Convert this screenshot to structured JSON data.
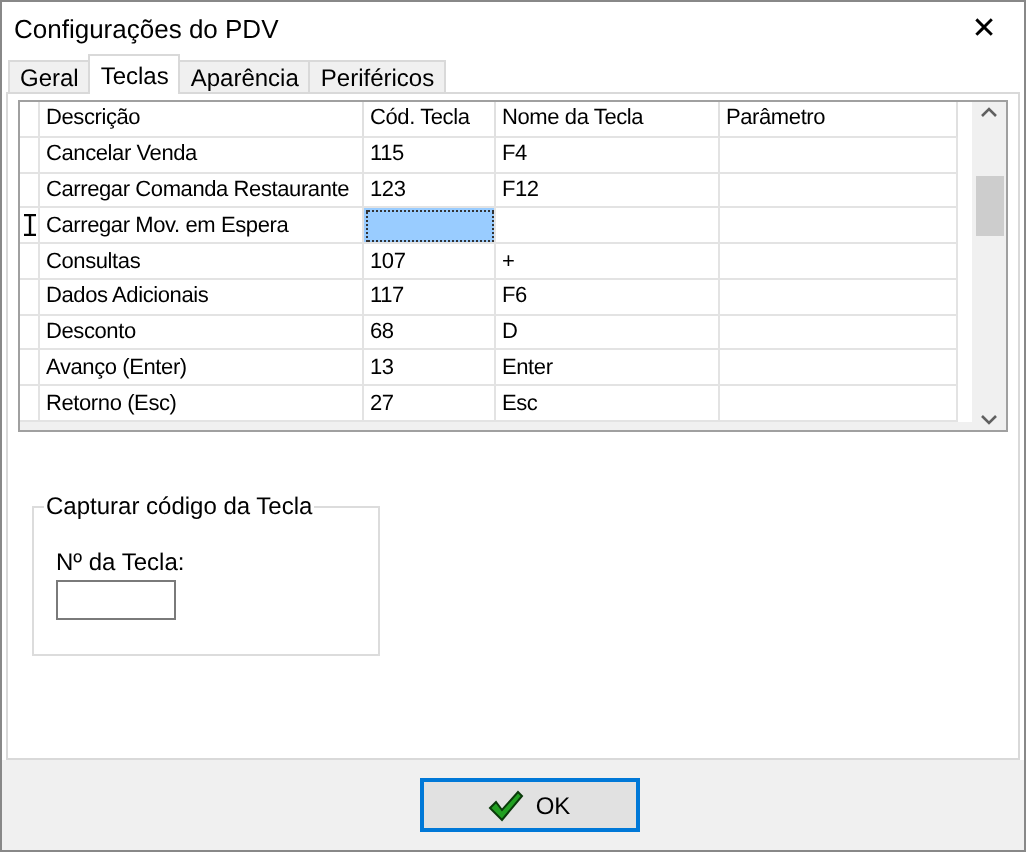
{
  "window": {
    "title": "Configurações do PDV",
    "close": "✕"
  },
  "tabs": [
    {
      "label": "Geral",
      "selected": false
    },
    {
      "label": "Teclas",
      "selected": true
    },
    {
      "label": "Aparência",
      "selected": false
    },
    {
      "label": "Periféricos",
      "selected": false
    }
  ],
  "table": {
    "columns": [
      "Descrição",
      "Cód. Tecla",
      "Nome da Tecla",
      "Parâmetro"
    ],
    "rows": [
      {
        "description": "Cancelar Venda",
        "code": "115",
        "key_name": "F4",
        "selected": false
      },
      {
        "description": "Carregar Comanda Restaurante",
        "code": "123",
        "key_name": "F12",
        "selected": false
      },
      {
        "description": "Carregar Mov. em Espera",
        "selected": true
      },
      {
        "description": "Consultas",
        "code": "107",
        "key_name": "+",
        "selected": false
      },
      {
        "description": "Dados Adicionais",
        "code": "117",
        "key_name": "F6",
        "selected": false
      },
      {
        "description": "Desconto",
        "code": "68",
        "key_name": "D",
        "selected": false
      },
      {
        "description": "Avanço (Enter)",
        "code": "13",
        "key_name": "Enter",
        "selected": false
      },
      {
        "description": "Retorno (Esc)",
        "code": "27",
        "key_name": "Esc",
        "selected": false
      }
    ]
  },
  "capture_group": {
    "title": "Capturar código da Tecla",
    "field_label": "Nº da Tecla:"
  },
  "ok_button": {
    "label": "OK"
  }
}
